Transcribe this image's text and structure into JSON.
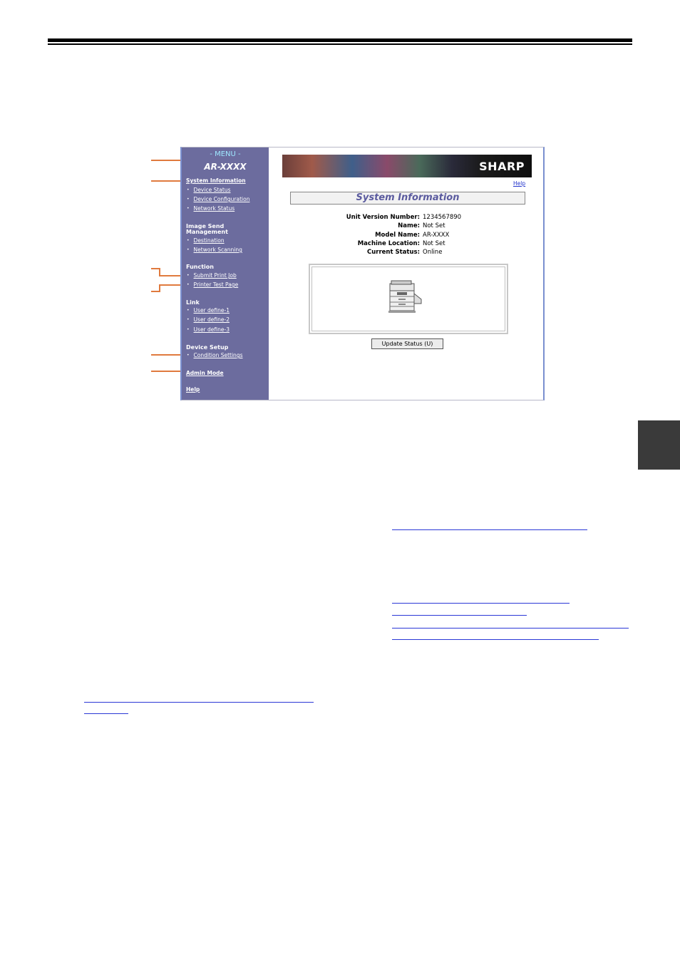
{
  "menu": {
    "title": "- MENU -",
    "model": "AR-XXXX",
    "system_information": {
      "heading": "System Information",
      "items": [
        "Device Status",
        "Device Configuration",
        "Network Status"
      ]
    },
    "image_send": {
      "heading_line1": "Image Send",
      "heading_line2": "Management",
      "items": [
        "Destination",
        "Network Scanning"
      ]
    },
    "function": {
      "heading": "Function",
      "items": [
        "Submit Print Job",
        "Printer Test Page"
      ]
    },
    "link": {
      "heading": "Link",
      "items": [
        "User define-1",
        "User define-2",
        "User define-3"
      ]
    },
    "device_setup": {
      "heading": "Device Setup",
      "items": [
        "Condition Settings"
      ]
    },
    "admin_mode": "Admin Mode",
    "help": "Help"
  },
  "content": {
    "brand": "SHARP",
    "help_link": "Help",
    "title": "System Information",
    "info": [
      {
        "label": "Unit Version Number:",
        "value": "1234567890"
      },
      {
        "label": "Name:",
        "value": "Not Set"
      },
      {
        "label": "Model Name:",
        "value": "AR-XXXX"
      },
      {
        "label": "Machine Location:",
        "value": "Not Set"
      },
      {
        "label": "Current Status:",
        "value": "Online"
      }
    ],
    "update_button": "Update Status (U)"
  },
  "colors": {
    "menu_bg": "#6c6c9e",
    "callout": "#e07a3e",
    "link_blue": "#2a37d6",
    "side_tab": "#3a3a3a"
  }
}
